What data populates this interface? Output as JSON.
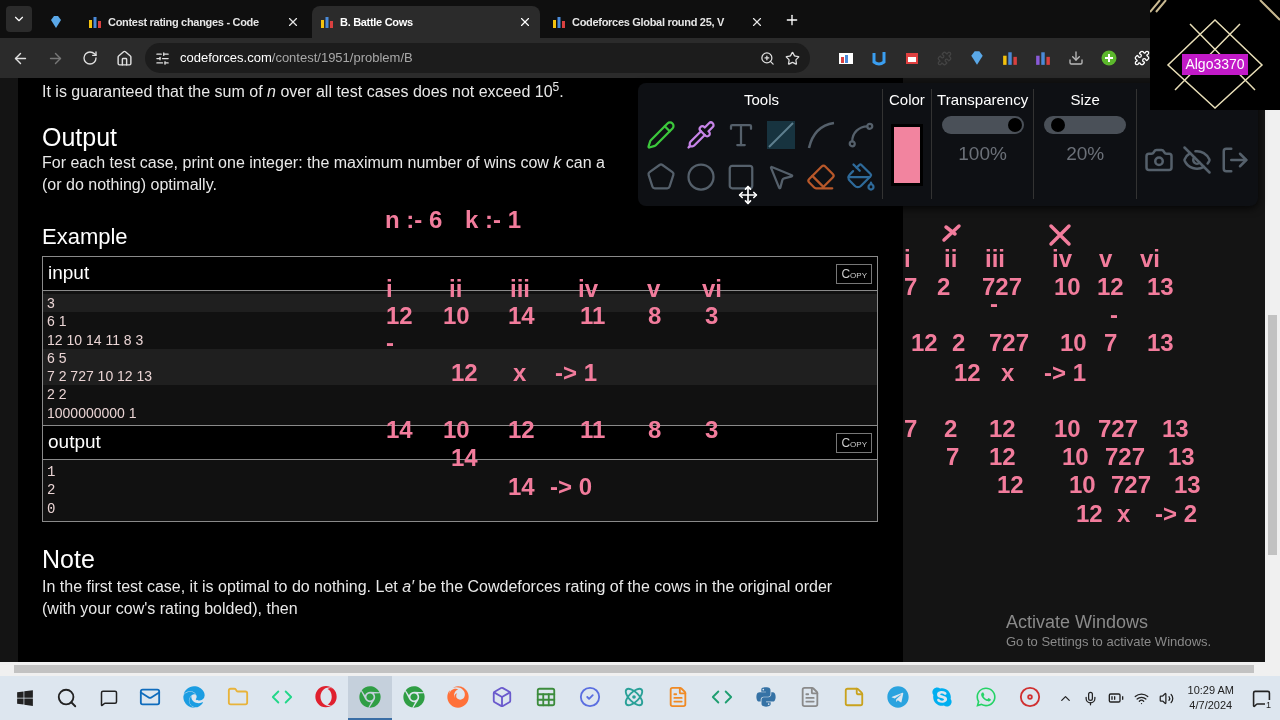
{
  "browser": {
    "tabs": [
      {
        "kind": "pinned",
        "selected": false
      },
      {
        "kind": "page",
        "title": "Contest rating changes - Code",
        "selected": false
      },
      {
        "kind": "page",
        "title": "B. Battle Cows",
        "selected": true
      },
      {
        "kind": "page",
        "title": "Codeforces Global round 25, V",
        "selected": false
      }
    ],
    "address": {
      "domain": "codeforces.com",
      "path": "/contest/1951/problem/B"
    }
  },
  "problem": {
    "intro": "It is guaranteed that the sum of *n* over all test cases does not exceed 10$^{5}$.",
    "output_heading": "Output",
    "output_lines": [
      "For each test case, print one integer: the maximum number of wins cow *k* can a",
      "(or do nothing) optimally."
    ],
    "example_heading": "Example",
    "example": [
      {
        "label": "input",
        "copy": "Copy",
        "lines": [
          {
            "text": "3",
            "shaded": true
          },
          {
            "text": "6 1",
            "shaded": false
          },
          {
            "text": "12 10 14 11 8 3",
            "shaded": false
          },
          {
            "text": "6 5",
            "shaded": true
          },
          {
            "text": "7 2 727 10 12 13",
            "shaded": true
          },
          {
            "text": "2 2",
            "shaded": false
          },
          {
            "text": "1000000000 1",
            "shaded": false
          }
        ]
      },
      {
        "label": "output",
        "copy": "Copy",
        "lines": [
          {
            "text": "1",
            "shaded": false
          },
          {
            "text": "2",
            "shaded": false
          },
          {
            "text": "0",
            "shaded": false
          }
        ]
      }
    ],
    "note_heading": "Note",
    "note": "In the first test case, it is optimal to do nothing. Let *a′* be the Cowdeforces rating of the cows in the original order (with your cow's rating bolded), then"
  },
  "annotations": {
    "left": [
      {
        "cells": [
          "n :- 6",
          "k :- 1"
        ]
      },
      {
        "cells": [
          "i",
          "ii",
          "iii",
          "iv",
          "v",
          "vi"
        ]
      },
      {
        "cells": [
          "12",
          "10",
          "14",
          "11",
          "8",
          "3"
        ]
      },
      {
        "cells": [
          "-"
        ]
      },
      {
        "cells": [
          "12",
          "x",
          "-> 1"
        ]
      },
      {
        "cells": [
          "14",
          "10",
          "12",
          "11",
          "8",
          "3"
        ]
      },
      {
        "cells": [
          "14"
        ]
      },
      {
        "cells": [
          "14",
          "-> 0"
        ]
      }
    ],
    "right": [
      {
        "cells": [
          "i",
          "ii",
          "iii",
          "iv",
          "v",
          "vi"
        ]
      },
      {
        "cells": [
          "7",
          "2",
          "727",
          "10",
          "12",
          "13"
        ]
      },
      {
        "cells": [
          "-"
        ]
      },
      {
        "cells": [
          "-"
        ]
      },
      {
        "cells": [
          "12",
          "2",
          "727",
          "10",
          "7",
          "13"
        ]
      },
      {
        "cells": [
          "12",
          "x",
          "-> 1"
        ]
      },
      {
        "cells": [
          "7",
          "2",
          "12",
          "10",
          "727",
          "13"
        ]
      },
      {
        "cells": [
          "7",
          "12",
          "10",
          "727",
          "13"
        ]
      },
      {
        "cells": [
          "12",
          "10",
          "727",
          "13"
        ]
      },
      {
        "cells": [
          "12",
          "x",
          "-> 2"
        ]
      }
    ]
  },
  "tools_panel": {
    "title": "Tools",
    "color_label": "Color",
    "color": "#f2849f",
    "transparency": {
      "label": "Transparency",
      "level": 1,
      "reading": "100%"
    },
    "size": {
      "label": "Size",
      "level": 0.08,
      "reading": "20%"
    }
  },
  "logo": {
    "text": "Algo3370"
  },
  "activation_notice": {
    "title": "Activate Windows",
    "subtitle": "Go to Settings to activate Windows."
  },
  "taskbar": {
    "apps": [
      {
        "kind": "mail",
        "active": false
      },
      {
        "kind": "edge",
        "active": false
      },
      {
        "kind": "folder",
        "active": false
      },
      {
        "kind": "ide",
        "active": false
      },
      {
        "kind": "opera",
        "active": false
      },
      {
        "kind": "chrome",
        "active": true
      },
      {
        "kind": "chrome",
        "active": false
      },
      {
        "kind": "firefox",
        "active": false
      },
      {
        "kind": "cube",
        "active": false
      },
      {
        "kind": "sheet",
        "active": false
      },
      {
        "kind": "check",
        "active": false
      },
      {
        "kind": "atom",
        "active": false
      },
      {
        "kind": "sublime",
        "active": false
      },
      {
        "kind": "code",
        "active": false
      },
      {
        "kind": "python",
        "active": false
      },
      {
        "kind": "file",
        "active": false
      },
      {
        "kind": "sticky",
        "active": false
      },
      {
        "kind": "telegram",
        "active": false
      },
      {
        "kind": "skype",
        "active": false
      },
      {
        "kind": "whatsapp",
        "active": false
      },
      {
        "kind": "recorder",
        "active": false
      }
    ],
    "time": "10:29 AM",
    "date": "4/7/2024",
    "notifications": "1"
  }
}
